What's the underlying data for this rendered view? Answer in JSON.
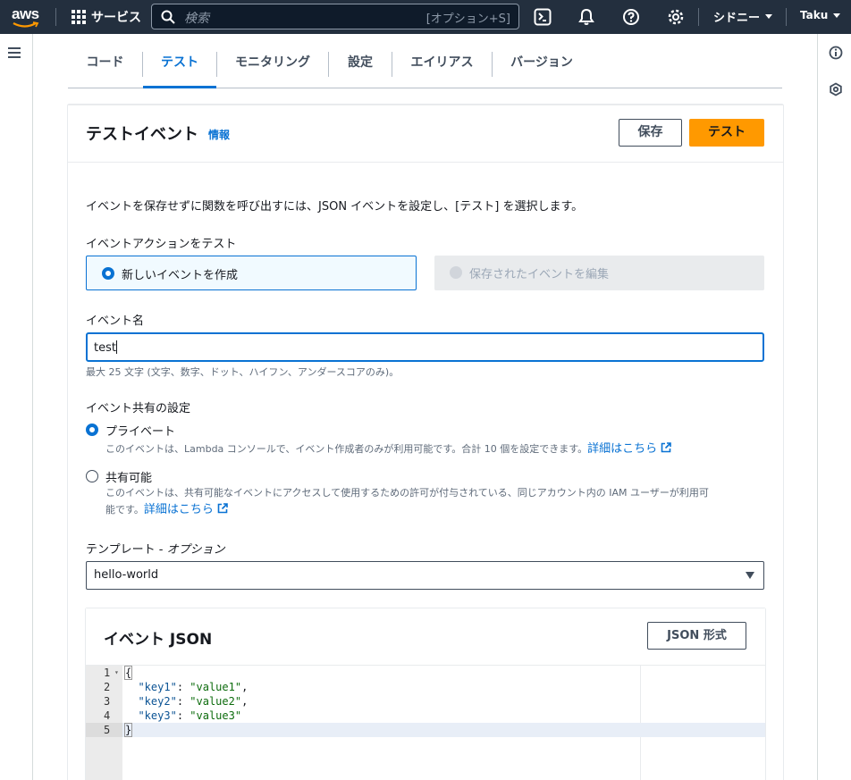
{
  "topnav": {
    "logo_text": "aws",
    "services_label": "サービス",
    "search_placeholder": "検索",
    "search_shortcut": "[オプション+S]",
    "region_label": "シドニー",
    "user_label": "Taku"
  },
  "tabs": [
    {
      "label": "コード",
      "active": false
    },
    {
      "label": "テスト",
      "active": true
    },
    {
      "label": "モニタリング",
      "active": false
    },
    {
      "label": "設定",
      "active": false
    },
    {
      "label": "エイリアス",
      "active": false
    },
    {
      "label": "バージョン",
      "active": false
    }
  ],
  "panel": {
    "title": "テストイベント",
    "info_link": "情報",
    "save_button": "保存",
    "test_button": "テスト",
    "description": "イベントを保存せずに関数を呼び出すには、JSON イベントを設定し、[テスト] を選択します。",
    "action_label": "イベントアクションをテスト",
    "action_options": {
      "create": "新しいイベントを作成",
      "edit": "保存されたイベントを編集"
    },
    "selected_action": "create",
    "event_name_label": "イベント名",
    "event_name_value": "test",
    "event_name_hint": "最大 25 文字 (文字、数字、ドット、ハイフン、アンダースコアのみ)。",
    "sharing_label": "イベント共有の設定",
    "sharing_selected": "private",
    "private_label": "プライベート",
    "private_desc": "このイベントは、Lambda コンソールで、イベント作成者のみが利用可能です。合計 10 個を設定できます。",
    "shareable_label": "共有可能",
    "shareable_desc_line1": "このイベントは、共有可能なイベントにアクセスして使用するための許可が付与されている、同じアカウント内の IAM ユーザーが利用可",
    "shareable_desc_line2": "能です。",
    "learn_more": "詳細はこちら",
    "template_label": "テンプレート - ",
    "template_label_option": "オプション",
    "template_value": "hello-world"
  },
  "json_editor": {
    "title": "イベント JSON",
    "format_button": "JSON 形式",
    "lines": [
      {
        "n": "1",
        "text": "{"
      },
      {
        "n": "2",
        "key": "\"key1\"",
        "value": "\"value1\"",
        "trail": ","
      },
      {
        "n": "3",
        "key": "\"key2\"",
        "value": "\"value2\"",
        "trail": ","
      },
      {
        "n": "4",
        "key": "\"key3\"",
        "value": "\"value3\"",
        "trail": ""
      },
      {
        "n": "5",
        "text": "}"
      }
    ]
  },
  "colors": {
    "accent": "#0972d3",
    "primary_button": "#ff9900",
    "topnav_bg": "#232f3e"
  }
}
